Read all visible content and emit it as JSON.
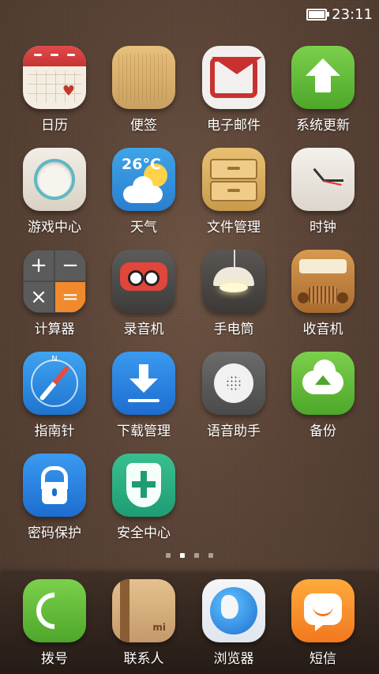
{
  "status_bar": {
    "time": "23:11",
    "battery_level": 1.0
  },
  "apps": [
    {
      "label": "日历",
      "icon": "calendar-icon"
    },
    {
      "label": "便签",
      "icon": "notes-icon"
    },
    {
      "label": "电子邮件",
      "icon": "mail-icon"
    },
    {
      "label": "系统更新",
      "icon": "update-icon"
    },
    {
      "label": "游戏中心",
      "icon": "game-center-icon"
    },
    {
      "label": "天气",
      "icon": "weather-icon",
      "temp_text": "26°C"
    },
    {
      "label": "文件管理",
      "icon": "file-manager-icon"
    },
    {
      "label": "时钟",
      "icon": "clock-icon"
    },
    {
      "label": "计算器",
      "icon": "calculator-icon"
    },
    {
      "label": "录音机",
      "icon": "recorder-icon"
    },
    {
      "label": "手电筒",
      "icon": "flashlight-icon"
    },
    {
      "label": "收音机",
      "icon": "radio-icon"
    },
    {
      "label": "指南针",
      "icon": "compass-icon"
    },
    {
      "label": "下载管理",
      "icon": "download-icon"
    },
    {
      "label": "语音助手",
      "icon": "voice-assistant-icon"
    },
    {
      "label": "备份",
      "icon": "backup-icon"
    },
    {
      "label": "密码保护",
      "icon": "lock-icon"
    },
    {
      "label": "安全中心",
      "icon": "security-center-icon"
    }
  ],
  "page_indicator": {
    "pages": 4,
    "active": 2
  },
  "dock": [
    {
      "label": "拨号",
      "icon": "phone-icon"
    },
    {
      "label": "联系人",
      "icon": "contacts-icon"
    },
    {
      "label": "浏览器",
      "icon": "browser-icon"
    },
    {
      "label": "短信",
      "icon": "sms-icon"
    }
  ]
}
